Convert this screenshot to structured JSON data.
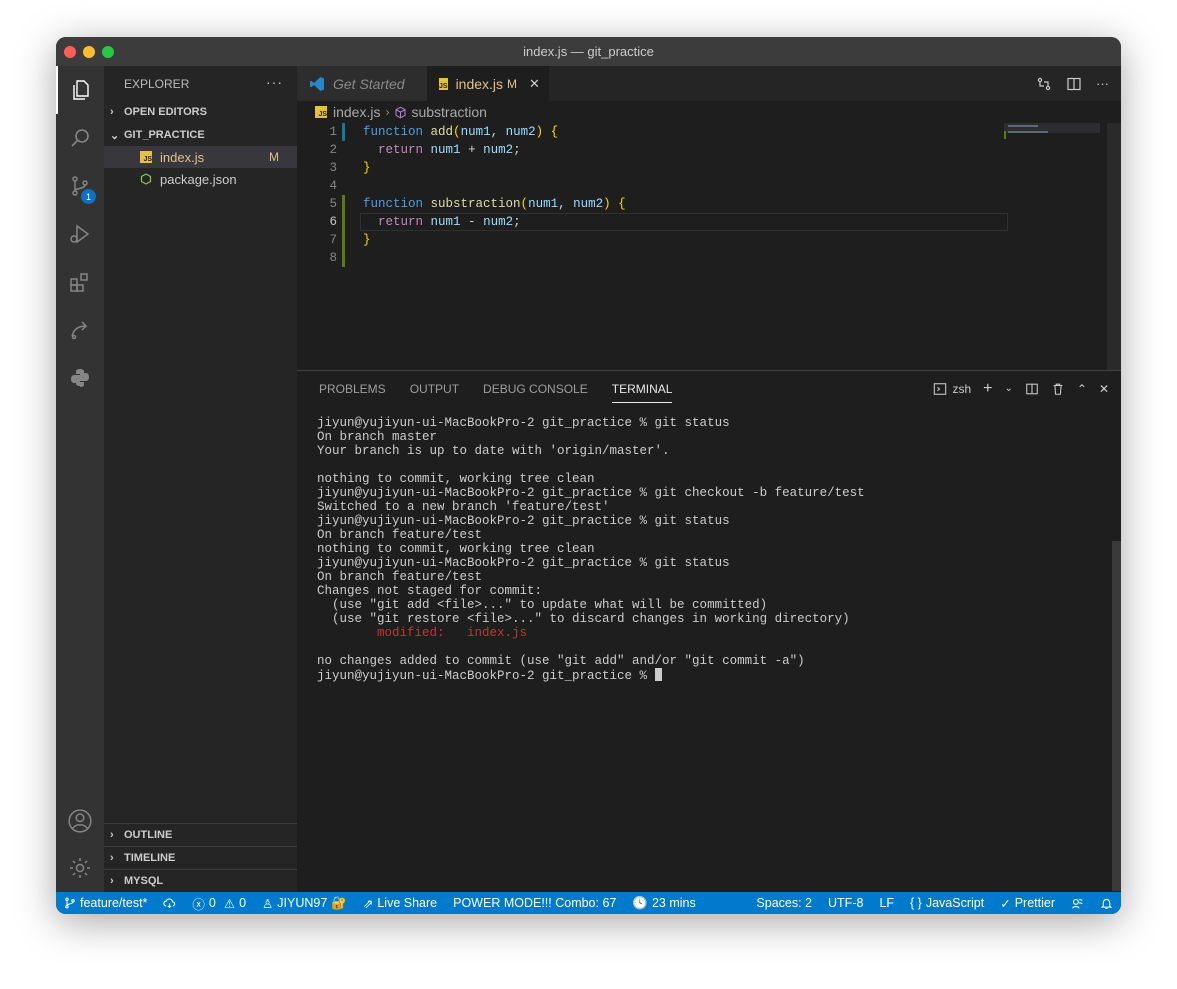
{
  "window": {
    "title": "index.js — git_practice"
  },
  "sidebar": {
    "title": "EXPLORER",
    "more": "···",
    "sections": {
      "open_editors": "OPEN EDITORS",
      "folder": "GIT_PRACTICE",
      "outline": "OUTLINE",
      "timeline": "TIMELINE",
      "mysql": "MYSQL"
    },
    "files": [
      {
        "name": "index.js",
        "status": "M",
        "icon": "js-file-icon"
      },
      {
        "name": "package.json",
        "status": "",
        "icon": "nodejs-file-icon"
      }
    ],
    "scm_badge": "1"
  },
  "tabs": [
    {
      "label": "Get Started",
      "active": false
    },
    {
      "label": "index.js",
      "status": "M",
      "close": "✕",
      "active": true
    }
  ],
  "breadcrumb": {
    "file": "index.js",
    "symbol": "substraction"
  },
  "editor": {
    "line_numbers": [
      "1",
      "2",
      "3",
      "4",
      "5",
      "6",
      "7",
      "8"
    ],
    "current_line": 6
  },
  "panel": {
    "tabs": [
      "PROBLEMS",
      "OUTPUT",
      "DEBUG CONSOLE",
      "TERMINAL"
    ],
    "active_tab": "TERMINAL",
    "shell": "zsh",
    "terminal_lines": [
      "jiyun@yujiyun-ui-MacBookPro-2 git_practice % git status",
      "On branch master",
      "Your branch is up to date with 'origin/master'.",
      "",
      "nothing to commit, working tree clean",
      "jiyun@yujiyun-ui-MacBookPro-2 git_practice % git checkout -b feature/test",
      "Switched to a new branch 'feature/test'",
      "jiyun@yujiyun-ui-MacBookPro-2 git_practice % git status",
      "On branch feature/test",
      "nothing to commit, working tree clean",
      "jiyun@yujiyun-ui-MacBookPro-2 git_practice % git status",
      "On branch feature/test",
      "Changes not staged for commit:",
      "  (use \"git add <file>...\" to update what will be committed)",
      "  (use \"git restore <file>...\" to discard changes in working directory)",
      "        modified:   index.js",
      "",
      "no changes added to commit (use \"git add\" and/or \"git commit -a\")",
      "jiyun@yujiyun-ui-MacBookPro-2 git_practice % "
    ],
    "modified_line_index": 15
  },
  "statusbar": {
    "branch": "feature/test*",
    "errors": "0",
    "warnings": "0",
    "user": "JIYUN97",
    "live_share": "Live Share",
    "power_mode": "POWER MODE!!! Combo: 67",
    "time": "23 mins",
    "spaces": "Spaces: 2",
    "encoding": "UTF-8",
    "eol": "LF",
    "language": "JavaScript",
    "formatter": "Prettier"
  },
  "colors": {
    "accent": "#007acc",
    "modified": "#e2c08d",
    "keyword": "#569cd6",
    "function": "#dcdcaa",
    "param": "#9cdcfe"
  }
}
